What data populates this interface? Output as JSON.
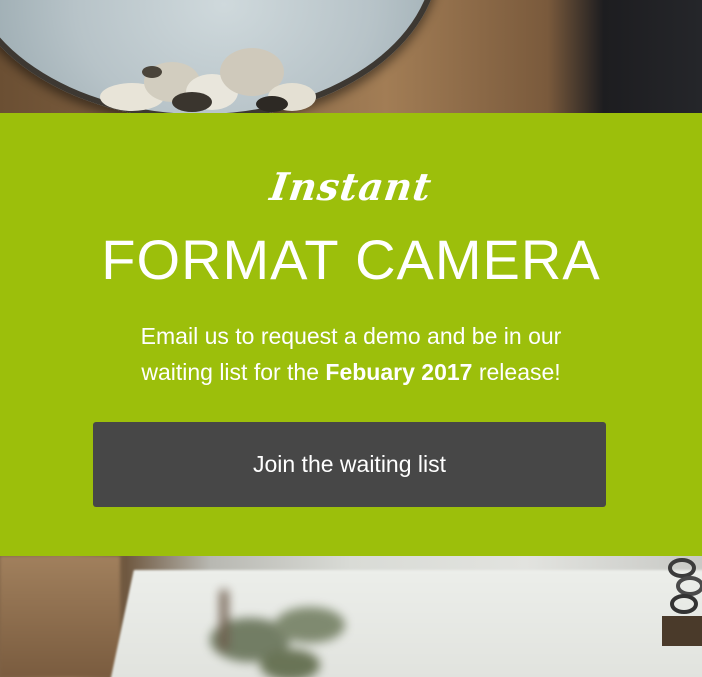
{
  "hero": {
    "subtitle": "Instant",
    "title": "FORMAT CAMERA",
    "description": {
      "line1": "Email us to request a demo and be in our",
      "line2_prefix": "waiting list for the ",
      "line2_bold": "Febuary 2017",
      "line2_suffix": " release!"
    },
    "cta_label": "Join the waiting list"
  },
  "colors": {
    "banner": "#9cbf0b",
    "button": "#474747",
    "text": "#ffffff"
  }
}
